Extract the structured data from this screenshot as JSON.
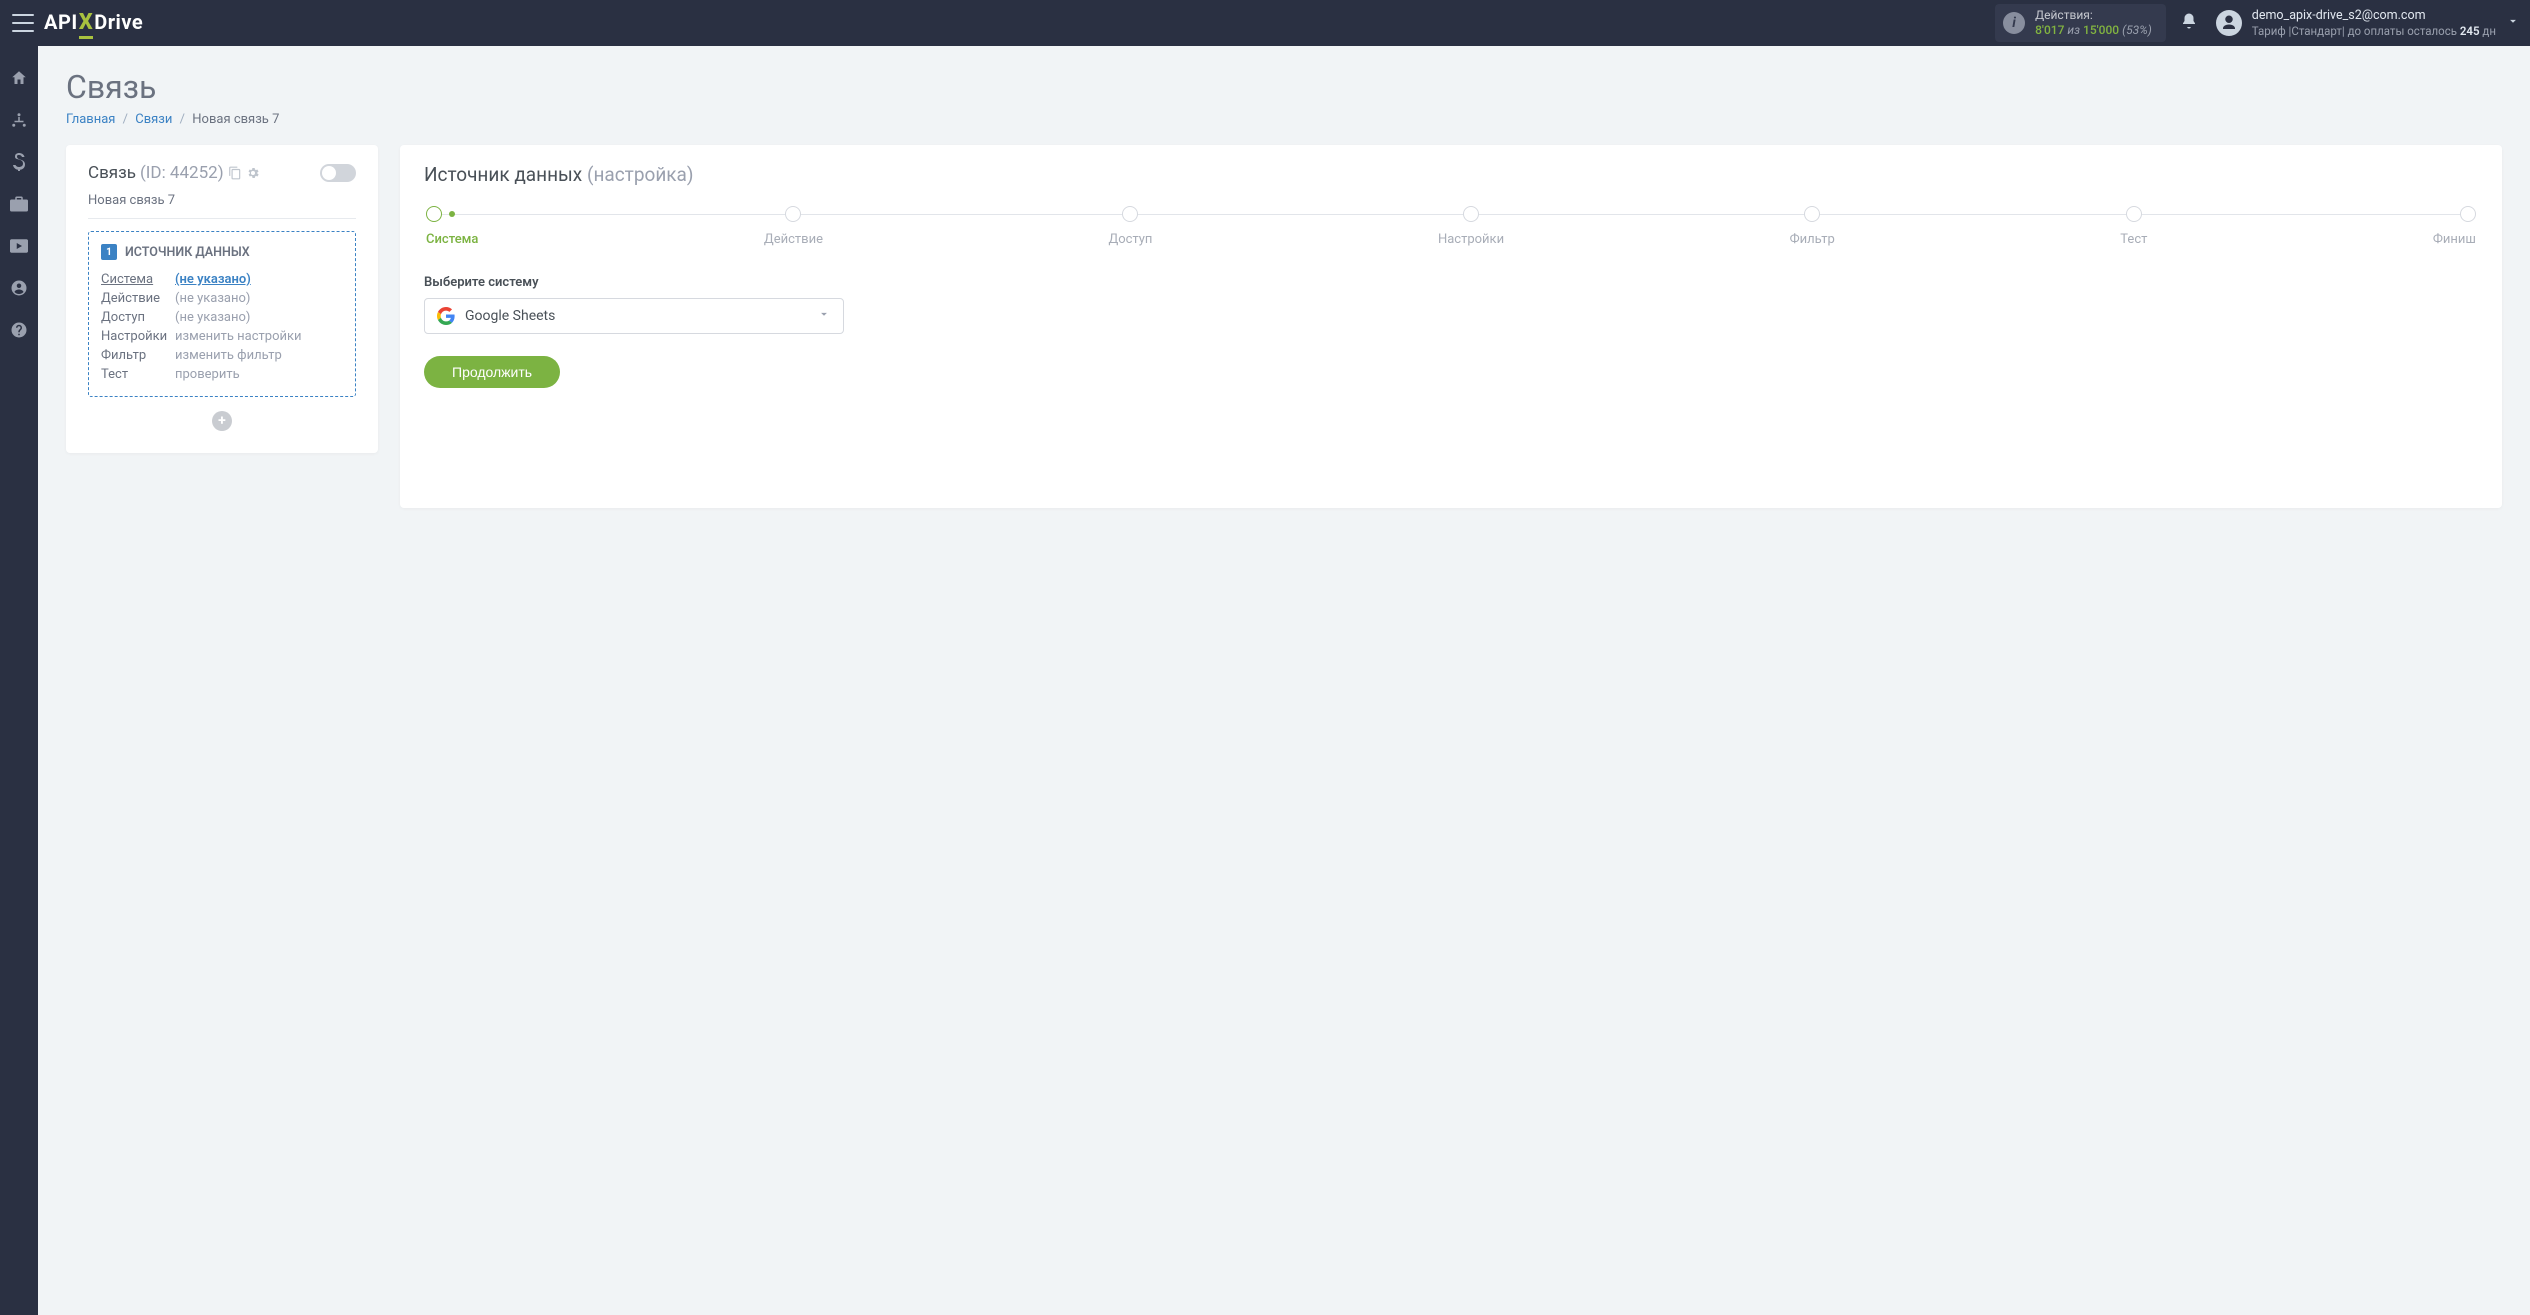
{
  "header": {
    "actions_label": "Действия:",
    "actions_used": "8'017",
    "actions_of": "из",
    "actions_total": "15'000",
    "actions_pct": "(53%)",
    "user_email": "demo_apix-drive_s2@com.com",
    "plan_prefix": "Тариф |Стандарт| до оплаты осталось ",
    "plan_days": "245",
    "plan_days_suffix": " дн"
  },
  "page": {
    "title": "Связь",
    "breadcrumb_home": "Главная",
    "breadcrumb_links": "Связи",
    "breadcrumb_current": "Новая связь 7"
  },
  "left_panel": {
    "title": "Связь",
    "id_label": "(ID: 44252)",
    "name": "Новая связь 7",
    "box_num": "1",
    "box_title": "ИСТОЧНИК ДАННЫХ",
    "rows": {
      "system_label": "Система",
      "system_value": "(не указано)",
      "action_label": "Действие",
      "action_value": "(не указано)",
      "access_label": "Доступ",
      "access_value": "(не указано)",
      "settings_label": "Настройки",
      "settings_value": "изменить настройки",
      "filter_label": "Фильтр",
      "filter_value": "изменить фильтр",
      "test_label": "Тест",
      "test_value": "проверить"
    }
  },
  "right_panel": {
    "title_main": "Источник данных",
    "title_sub": "(настройка)",
    "steps": [
      "Система",
      "Действие",
      "Доступ",
      "Настройки",
      "Фильтр",
      "Тест",
      "Финиш"
    ],
    "select_label": "Выберите систему",
    "select_value": "Google Sheets",
    "continue": "Продолжить"
  }
}
